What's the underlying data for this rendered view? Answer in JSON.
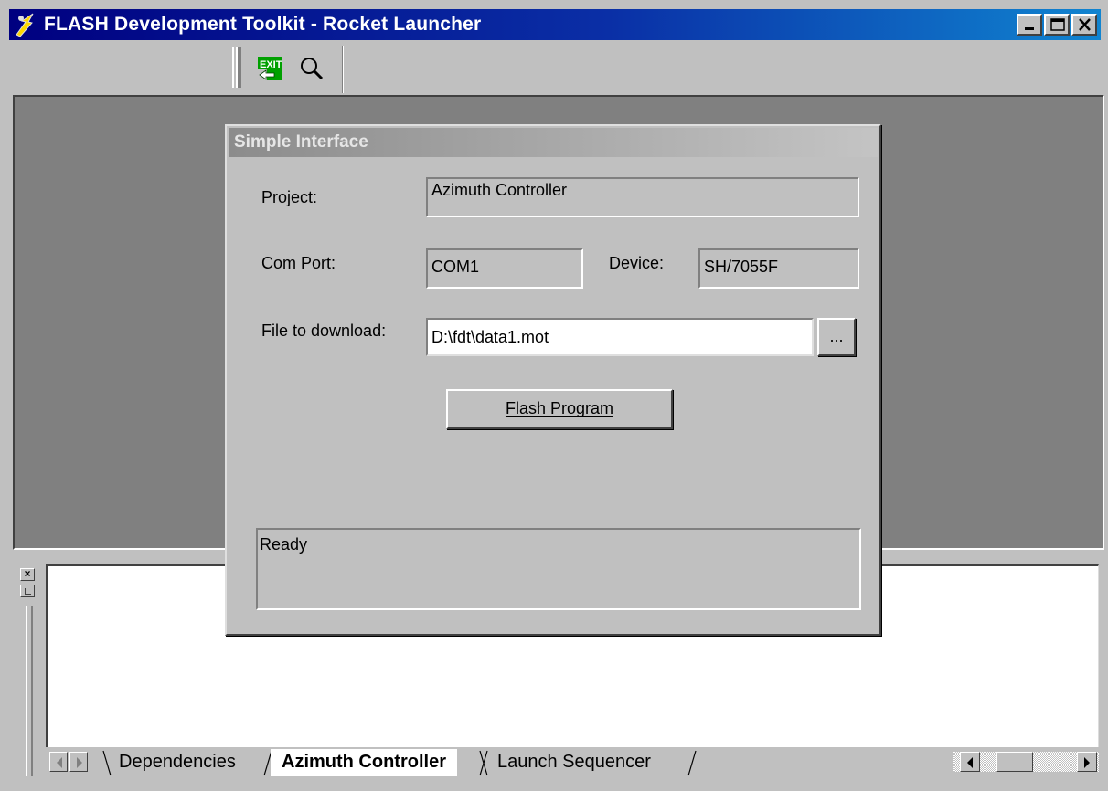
{
  "window": {
    "title": "FLASH Development Toolkit - Rocket Launcher",
    "controls": {
      "minimize_icon": "minimize-icon",
      "maximize_icon": "maximize-icon",
      "close_icon": "close-icon"
    }
  },
  "toolbar": {
    "buttons": [
      {
        "icon": "exit-icon",
        "label": "EXIT"
      },
      {
        "icon": "magnifier-icon"
      }
    ]
  },
  "dialog": {
    "title": "Simple Interface",
    "project_label": "Project:",
    "project_value": "Azimuth Controller",
    "com_port_label": "Com Port:",
    "com_port_value": "COM1",
    "device_label": "Device:",
    "device_value": "SH/7055F",
    "file_label": "File to download:",
    "file_value": "D:\\fdt\\data1.mot",
    "browse_label": "...",
    "flash_button_label": "Flash Program",
    "status_text": "Ready"
  },
  "output_pane": {
    "close_glyph": "×",
    "tabs": [
      {
        "label": "Dependencies",
        "active": false
      },
      {
        "label": "Azimuth Controller",
        "active": true
      },
      {
        "label": "Launch Sequencer",
        "active": false
      }
    ]
  },
  "colors": {
    "titlebar_start": "#000080",
    "titlebar_end": "#1084d0",
    "face": "#c0c0c0",
    "mdi_background": "#808080"
  }
}
